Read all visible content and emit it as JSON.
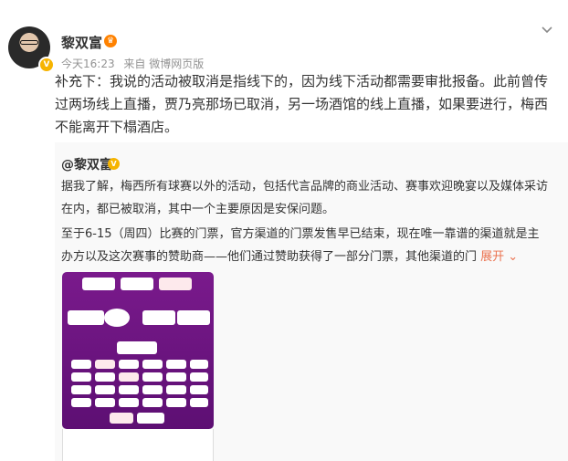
{
  "post": {
    "author": "黎双富",
    "time": "今天16:23",
    "source": "来自 微博网页版",
    "content": "补充下：我说的活动被取消是指线下的，因为线下活动都需要审批报备。此前曾传过两场线上直播，贾乃亮那场已取消，另一场酒馆的线上直播，如果要进行，梅西不能离开下榻酒店。"
  },
  "repost": {
    "author": "@黎双富",
    "p1": "据我了解，梅西所有球赛以外的活动，包括代言品牌的商业活动、赛事欢迎晚宴以及媒体采访在内，都已被取消，其中一个主要原因是安保问题。",
    "p2": "至于6-15（周四）比赛的门票，官方渠道的门票发售早已结束，现在唯一靠谱的渠道就是主办方以及这次赛事的赞助商——他们通过赞助获得了一部分门票，其他渠道的门",
    "expand": "展开"
  },
  "icons": {
    "verified": "verified-badge-icon",
    "crown": "crown-icon",
    "more": "chevron-down-icon",
    "expand": "expand-chevron-icon"
  },
  "colors": {
    "expand": "#eb7350",
    "badge": "#f6b400",
    "poster": "#6b1580"
  }
}
